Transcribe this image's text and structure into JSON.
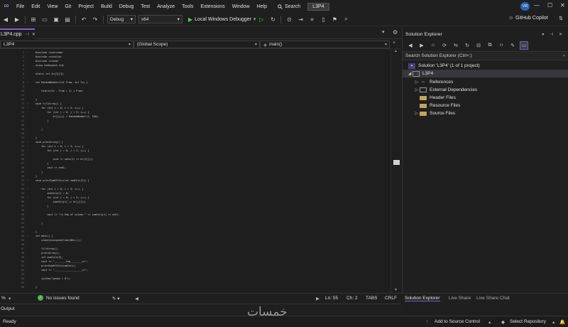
{
  "menubar": {
    "items": [
      "File",
      "Edit",
      "View",
      "Git",
      "Project",
      "Build",
      "Debug",
      "Test",
      "Analyze",
      "Tools",
      "Extensions",
      "Window",
      "Help"
    ],
    "search_label": "Search",
    "solution_name": "L3P4",
    "user_initials": "VR"
  },
  "toolbar": {
    "config": "Debug",
    "platform": "x64",
    "run_label": "Local Windows Debugger",
    "copilot_label": "GitHub Copilot"
  },
  "editor": {
    "tab_label": "L3P4.cpp",
    "nav_project": "L3P4",
    "nav_scope": "(Global Scope)",
    "nav_member": "main()",
    "lines": [
      {
        "n": "1",
        "fold": "-",
        "text": "#include <iostream>"
      },
      {
        "n": "2",
        "fold": "",
        "text": "#include <cstdlib>"
      },
      {
        "n": "3",
        "fold": "",
        "text": "#include <ctime>"
      },
      {
        "n": "4",
        "fold": "",
        "text": "using namespace std;"
      },
      {
        "n": "5",
        "fold": "",
        "text": ""
      },
      {
        "n": "6",
        "fold": "",
        "text": "static int Ar[3][3];"
      },
      {
        "n": "7",
        "fold": "",
        "text": ""
      },
      {
        "n": "8",
        "fold": "-",
        "text": "int RandomNumber(int From, int To) {"
      },
      {
        "n": "9",
        "fold": "",
        "text": ""
      },
      {
        "n": "10",
        "fold": "",
        "text": "    return(To - From + 1) + From;"
      },
      {
        "n": "11",
        "fold": "",
        "text": ""
      },
      {
        "n": "12",
        "fold": "",
        "text": "}"
      },
      {
        "n": "13",
        "fold": "-",
        "text": "void fillArray() {"
      },
      {
        "n": "14",
        "fold": "-",
        "text": "    for (int i = 0; i < 3; i++) {"
      },
      {
        "n": "15",
        "fold": "-",
        "text": "        for (int j = 0; j < 3; j++) {"
      },
      {
        "n": "16",
        "fold": "",
        "text": "            Ar[i][j] = RandomNumber(1, 100);"
      },
      {
        "n": "17",
        "fold": "",
        "text": "        }"
      },
      {
        "n": "18",
        "fold": "",
        "text": ""
      },
      {
        "n": "19",
        "fold": "",
        "text": "    }"
      },
      {
        "n": "20",
        "fold": "",
        "text": ""
      },
      {
        "n": "21",
        "fold": "",
        "text": "}"
      },
      {
        "n": "22",
        "fold": "-",
        "text": "void printArray() {"
      },
      {
        "n": "23",
        "fold": "-",
        "text": "    for (int i = 0; i < 3; i++) {"
      },
      {
        "n": "24",
        "fold": "-",
        "text": "        for (int j = 0; j < 3; j++) {"
      },
      {
        "n": "25",
        "fold": "",
        "text": ""
      },
      {
        "n": "26",
        "fold": "",
        "text": "            cout << setw(3) << Ar[i][j];"
      },
      {
        "n": "27",
        "fold": "",
        "text": "        }"
      },
      {
        "n": "28",
        "fold": "",
        "text": "        cout << endl;"
      },
      {
        "n": "29",
        "fold": "",
        "text": "    }"
      },
      {
        "n": "30",
        "fold": "",
        "text": "}"
      },
      {
        "n": "31",
        "fold": "-",
        "text": "void printSumOfCols(int sumCols[3]) {"
      },
      {
        "n": "32",
        "fold": "",
        "text": ""
      },
      {
        "n": "33",
        "fold": "-",
        "text": "    for (int i = 0; i < 3; i++) {"
      },
      {
        "n": "34",
        "fold": "",
        "text": "        sumCols[i] = 0;"
      },
      {
        "n": "35",
        "fold": "-",
        "text": "        for (int j = 0; j < 3; j++) {"
      },
      {
        "n": "36",
        "fold": "",
        "text": "            sumCols[i] += Ar[j][i];"
      },
      {
        "n": "37",
        "fold": "",
        "text": "        }"
      },
      {
        "n": "38",
        "fold": "",
        "text": ""
      },
      {
        "n": "39",
        "fold": "",
        "text": "        cout << \"\\n Sum of column \" << sumCols[i] << endl;"
      },
      {
        "n": "40",
        "fold": "",
        "text": ""
      },
      {
        "n": "41",
        "fold": "",
        "text": "    }"
      },
      {
        "n": "42",
        "fold": "",
        "text": ""
      },
      {
        "n": "43",
        "fold": "",
        "text": "}"
      },
      {
        "n": "44",
        "fold": "-",
        "text": "int main() {"
      },
      {
        "n": "45",
        "fold": "",
        "text": "    srand(unsigned(time(NULL)));"
      },
      {
        "n": "46",
        "fold": "",
        "text": ""
      },
      {
        "n": "47",
        "fold": "",
        "text": "    fillArray();"
      },
      {
        "n": "48",
        "fold": "",
        "text": "    printArray();"
      },
      {
        "n": "49",
        "fold": "",
        "text": "    int sumCols[3];"
      },
      {
        "n": "50",
        "fold": "",
        "text": "    cout << \"________Sum________\\n\";"
      },
      {
        "n": "51",
        "fold": "",
        "text": "    printSumOfCols(sumCols);"
      },
      {
        "n": "52",
        "fold": "",
        "text": "    cout << \"___________________\\n\";"
      },
      {
        "n": "53",
        "fold": "",
        "text": ""
      },
      {
        "n": "54",
        "fold": "",
        "text": "    system(\"pause > 0\");"
      },
      {
        "n": "55",
        "fold": "",
        "text": ""
      },
      {
        "n": "56",
        "fold": "",
        "text": "}"
      }
    ]
  },
  "editor_status": {
    "zoom": "%",
    "issues": "No issues found",
    "line": "Ln: 55",
    "col": "Ch: 2",
    "tabs": "TABS",
    "eol": "CRLF"
  },
  "output_tab": "Output",
  "solution_explorer": {
    "title": "Solution Explorer",
    "search_placeholder": "Search Solution Explorer (Ctrl+;)",
    "items": [
      {
        "label": "Solution 'L3P4' (1 of 1 project)",
        "icon": "solution-icon"
      },
      {
        "label": "L3P4",
        "icon": "project-icon"
      },
      {
        "label": "References",
        "icon": "references-icon"
      },
      {
        "label": "External Dependencies",
        "icon": "external-deps-icon"
      },
      {
        "label": "Header Files",
        "icon": "folder-icon"
      },
      {
        "label": "Resource Files",
        "icon": "folder-icon"
      },
      {
        "label": "Source Files",
        "icon": "folder-icon"
      }
    ],
    "bottom_tabs": [
      "Solution Explorer",
      "Live Share",
      "Live Share Chat"
    ]
  },
  "statusbar": {
    "ready": "Ready",
    "add_source": "Add to Source Control",
    "select_repo": "Select Repository"
  },
  "watermark": "خمسات",
  "colors": {
    "accent": "#7c63c9",
    "run_green": "#4ec94e",
    "ok_green": "#4caf50"
  }
}
